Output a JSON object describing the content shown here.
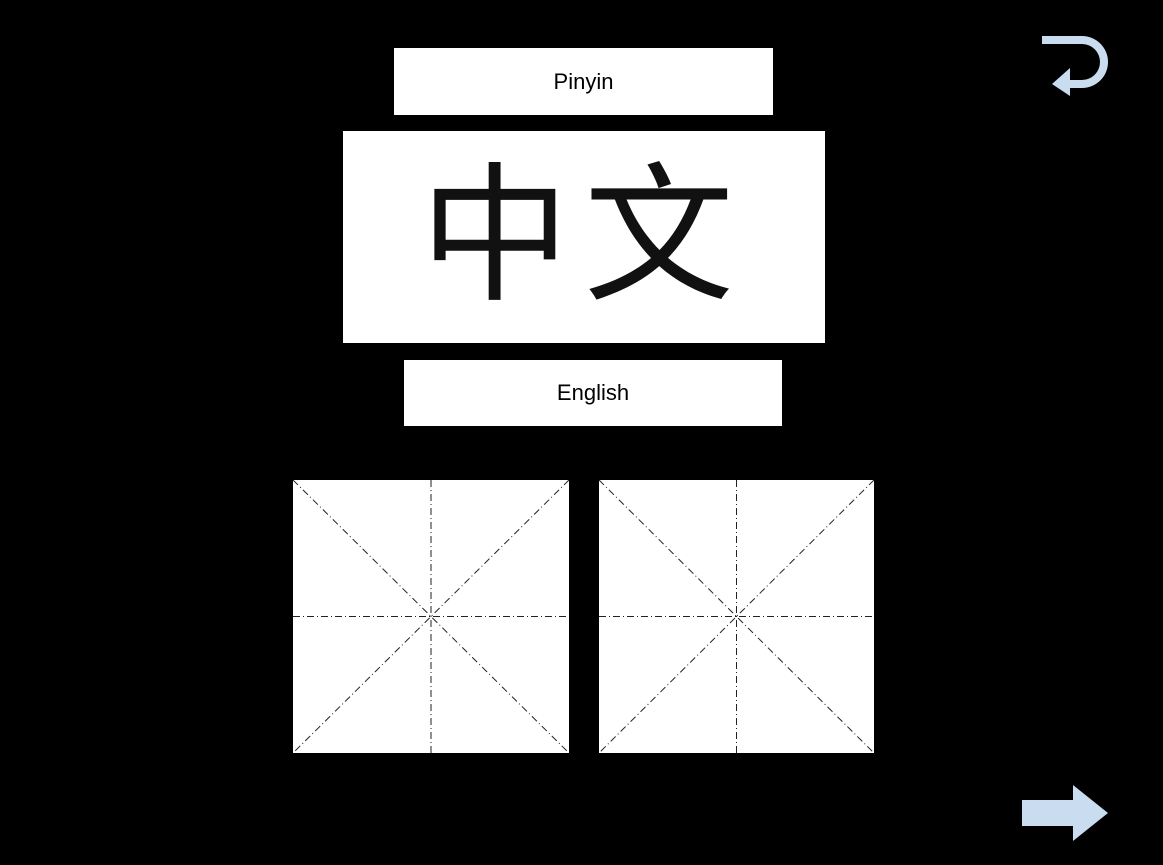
{
  "card": {
    "pinyin_label": "Pinyin",
    "hanzi": "中文",
    "english_label": "English"
  },
  "practice_grids": [
    {
      "name": "grid-1"
    },
    {
      "name": "grid-2"
    }
  ],
  "icons": {
    "return": "return-arrow-icon",
    "next": "next-arrow-icon"
  },
  "colors": {
    "background": "#000000",
    "card": "#ffffff",
    "ink": "#111111",
    "icon": "#c9dcf0"
  }
}
